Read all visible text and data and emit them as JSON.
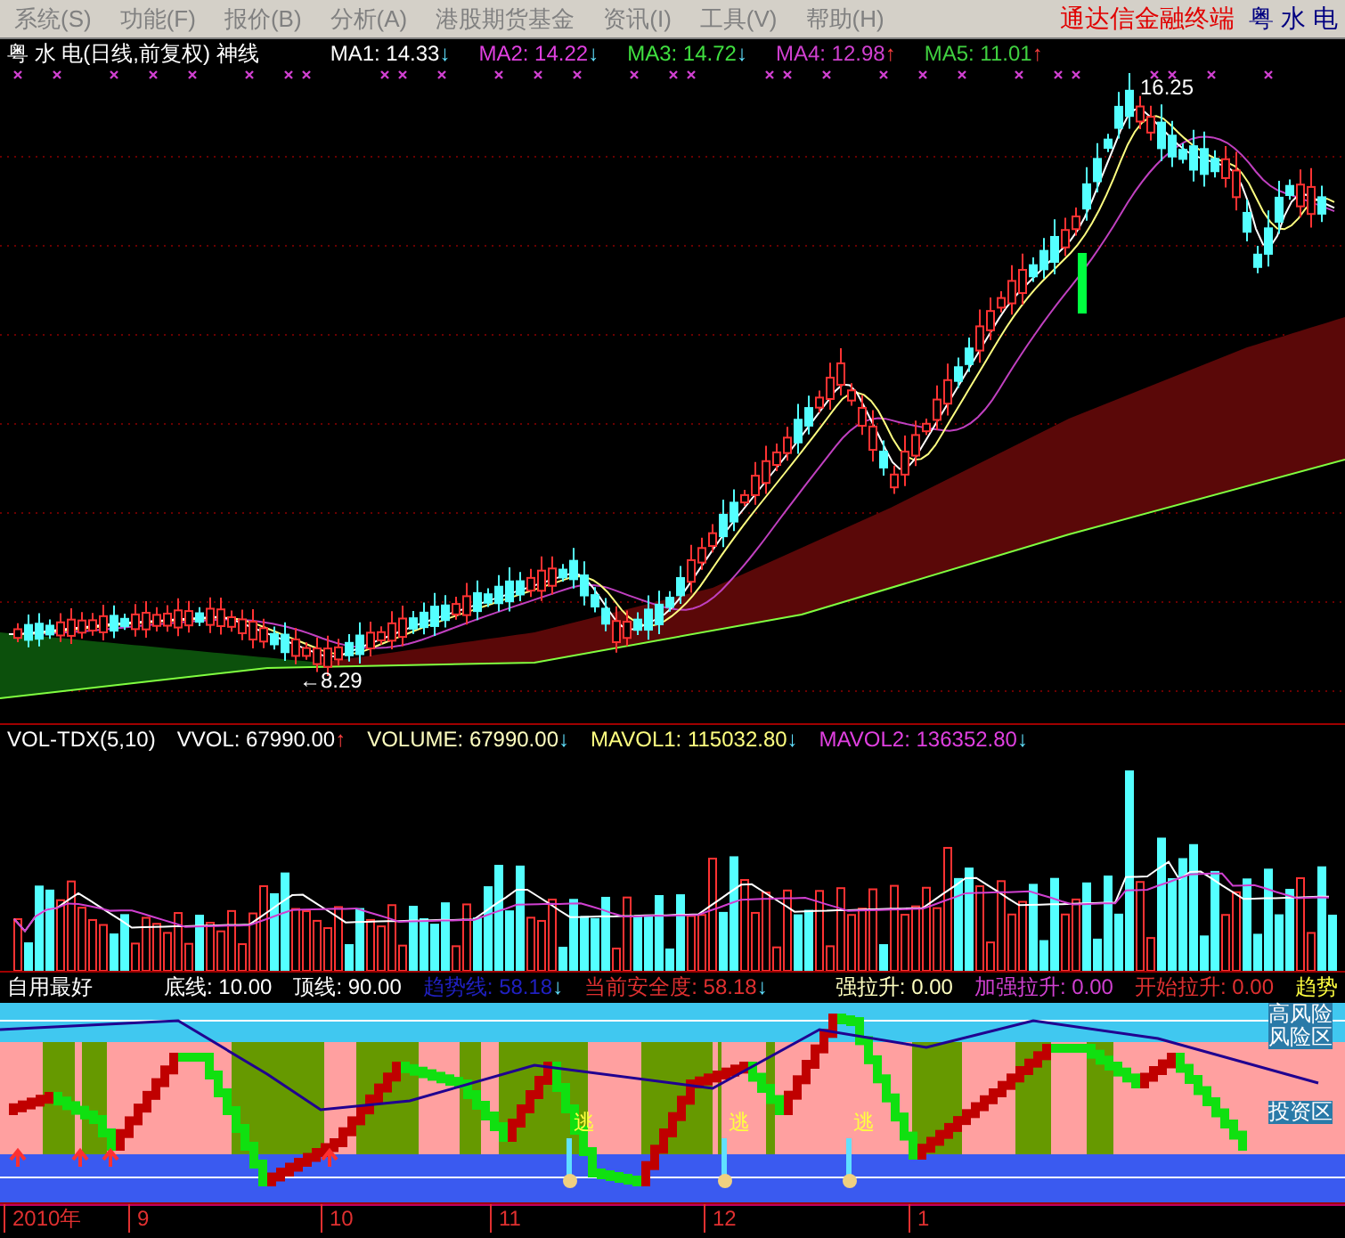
{
  "menu": {
    "items": [
      {
        "label": "系统(S)"
      },
      {
        "label": "功能(F)"
      },
      {
        "label": "报价(B)"
      },
      {
        "label": "分析(A)"
      },
      {
        "label": "港股期货基金"
      },
      {
        "label": "资讯(I)"
      },
      {
        "label": "工具(V)"
      },
      {
        "label": "帮助(H)"
      }
    ],
    "brand": "通达信金融终端",
    "stock": "粤 水 电"
  },
  "main_panel": {
    "title": "粤 水 电(日线,前复权) 神线",
    "indicators": [
      {
        "label": "MA1: 14.33",
        "color": "#ffffff",
        "arrow": "↓",
        "rising": false
      },
      {
        "label": "MA2: 14.22",
        "color": "#e040e0",
        "arrow": "↓",
        "rising": false
      },
      {
        "label": "MA3: 14.72",
        "color": "#40e040",
        "arrow": "↓",
        "rising": false
      },
      {
        "label": "MA4: 12.98",
        "color": "#d040d0",
        "arrow": "↑",
        "rising": true
      },
      {
        "label": "MA5: 11.01",
        "color": "#40d040",
        "arrow": "↑",
        "rising": true
      }
    ],
    "annotations": [
      {
        "text": "16.25"
      },
      {
        "text": "←8.29"
      }
    ]
  },
  "volume_panel": {
    "title": "VOL-TDX(5,10)",
    "indicators": [
      {
        "label": "VVOL: 67990.00",
        "color": "#ffffff",
        "arrow": "↑",
        "rising": true
      },
      {
        "label": "VOLUME: 67990.00",
        "color": "#ffffc0",
        "arrow": "↓",
        "rising": false
      },
      {
        "label": "MAVOL1: 115032.80",
        "color": "#ffff80",
        "arrow": "↓",
        "rising": false
      },
      {
        "label": "MAVOL2: 136352.80",
        "color": "#e040e0",
        "arrow": "↓",
        "rising": false
      }
    ]
  },
  "indicator_panel": {
    "title": "自用最好",
    "indicators": [
      {
        "label": "底线: 10.00"
      },
      {
        "label": "顶线: 90.00"
      },
      {
        "label": "趋势线: 58.18",
        "arrow": "↓",
        "rising": false
      },
      {
        "label": "当前安全度: 58.18",
        "arrow": "↓",
        "rising": false
      }
    ],
    "right_indicators": [
      {
        "label": "强拉升: 0.00"
      },
      {
        "label": "加强拉升: 0.00"
      },
      {
        "label": "开始拉升: 0.00"
      },
      {
        "label": "趋势"
      }
    ],
    "zone_labels": [
      {
        "text": "高风险"
      },
      {
        "text": "风险区"
      },
      {
        "text": "投资区"
      }
    ],
    "signals": [
      {
        "text": "逃"
      },
      {
        "text": "逃"
      },
      {
        "text": "逃"
      }
    ]
  },
  "x_axis": {
    "labels": [
      "2010年",
      "9",
      "10",
      "11",
      "12",
      "1"
    ]
  }
}
